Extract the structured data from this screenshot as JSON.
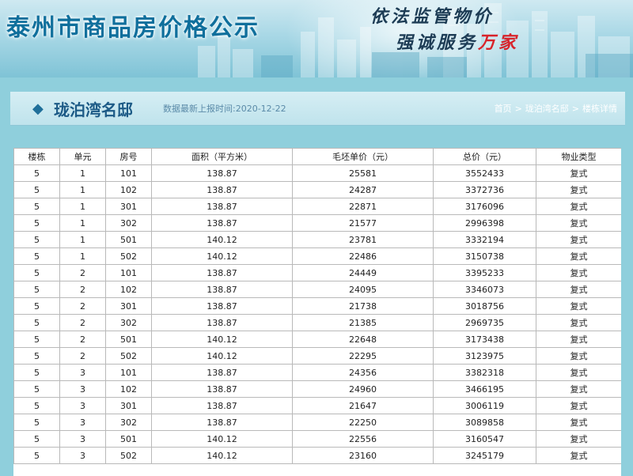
{
  "banner": {
    "site_title": "泰州市商品房价格公示",
    "slogan_line1": "依法监管物价",
    "slogan_line2_black": "强诚服务",
    "slogan_line2_red": "万家"
  },
  "header": {
    "title": "珑泊湾名邸",
    "report_date": "数据最新上报时间:2020-12-22",
    "breadcrumb": [
      "首页",
      "珑泊湾名邸",
      "楼栋详情"
    ]
  },
  "table": {
    "columns": [
      "楼栋",
      "单元",
      "房号",
      "面积（平方米）",
      "毛坯单价（元）",
      "总价（元）",
      "物业类型"
    ],
    "rows": [
      [
        "5",
        "1",
        "101",
        "138.87",
        "25581",
        "3552433",
        "复式"
      ],
      [
        "5",
        "1",
        "102",
        "138.87",
        "24287",
        "3372736",
        "复式"
      ],
      [
        "5",
        "1",
        "301",
        "138.87",
        "22871",
        "3176096",
        "复式"
      ],
      [
        "5",
        "1",
        "302",
        "138.87",
        "21577",
        "2996398",
        "复式"
      ],
      [
        "5",
        "1",
        "501",
        "140.12",
        "23781",
        "3332194",
        "复式"
      ],
      [
        "5",
        "1",
        "502",
        "140.12",
        "22486",
        "3150738",
        "复式"
      ],
      [
        "5",
        "2",
        "101",
        "138.87",
        "24449",
        "3395233",
        "复式"
      ],
      [
        "5",
        "2",
        "102",
        "138.87",
        "24095",
        "3346073",
        "复式"
      ],
      [
        "5",
        "2",
        "301",
        "138.87",
        "21738",
        "3018756",
        "复式"
      ],
      [
        "5",
        "2",
        "302",
        "138.87",
        "21385",
        "2969735",
        "复式"
      ],
      [
        "5",
        "2",
        "501",
        "140.12",
        "22648",
        "3173438",
        "复式"
      ],
      [
        "5",
        "2",
        "502",
        "140.12",
        "22295",
        "3123975",
        "复式"
      ],
      [
        "5",
        "3",
        "101",
        "138.87",
        "24356",
        "3382318",
        "复式"
      ],
      [
        "5",
        "3",
        "102",
        "138.87",
        "24960",
        "3466195",
        "复式"
      ],
      [
        "5",
        "3",
        "301",
        "138.87",
        "21647",
        "3006119",
        "复式"
      ],
      [
        "5",
        "3",
        "302",
        "138.87",
        "22250",
        "3089858",
        "复式"
      ],
      [
        "5",
        "3",
        "501",
        "140.12",
        "22556",
        "3160547",
        "复式"
      ],
      [
        "5",
        "3",
        "502",
        "140.12",
        "23160",
        "3245179",
        "复式"
      ]
    ]
  }
}
